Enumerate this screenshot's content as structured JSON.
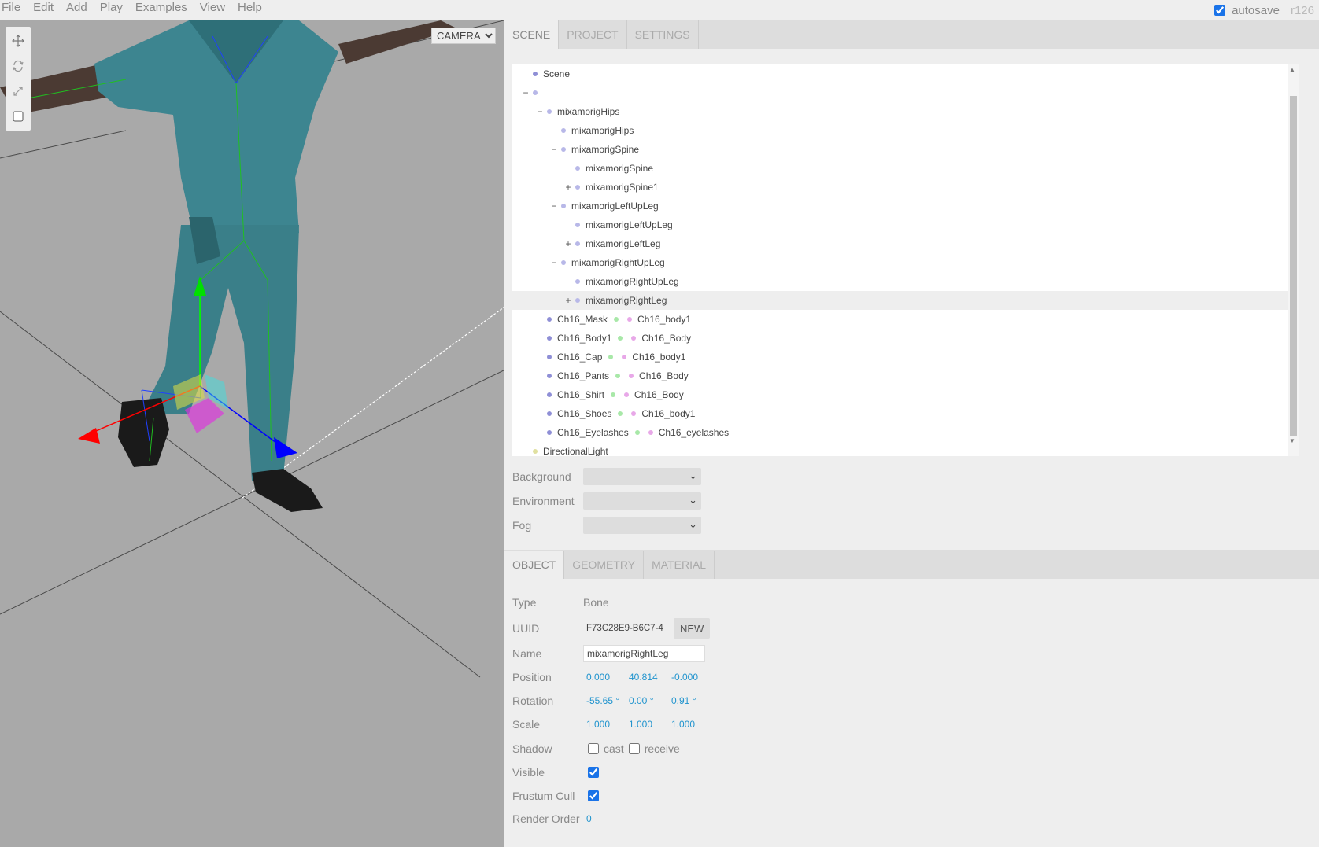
{
  "menubar": {
    "items": [
      "File",
      "Edit",
      "Add",
      "Play",
      "Examples",
      "View",
      "Help"
    ],
    "autosave_label": "autosave",
    "autosave_checked": true,
    "version": "r126"
  },
  "viewport": {
    "camera_select": "CAMERA",
    "tools": [
      "translate-icon",
      "rotate-icon",
      "scale-icon",
      "local-icon"
    ]
  },
  "sidebar": {
    "tabs": [
      "SCENE",
      "PROJECT",
      "SETTINGS"
    ],
    "selected_tab": "SCENE",
    "outliner": [
      {
        "opener": "",
        "level": 0,
        "label": "Scene",
        "dot": "#8f8fd6"
      },
      {
        "opener": "−",
        "level": 0,
        "label": "",
        "dot": "#b8b8e8"
      },
      {
        "opener": "−",
        "level": 1,
        "label": "mixamorigHips",
        "dot": "#b8b8e8"
      },
      {
        "opener": "",
        "level": 2,
        "label": "mixamorigHips",
        "dot": "#b8b8e8"
      },
      {
        "opener": "−",
        "level": 2,
        "label": "mixamorigSpine",
        "dot": "#b8b8e8"
      },
      {
        "opener": "",
        "level": 3,
        "label": "mixamorigSpine",
        "dot": "#b8b8e8"
      },
      {
        "opener": "+",
        "level": 3,
        "label": "mixamorigSpine1",
        "dot": "#b8b8e8"
      },
      {
        "opener": "−",
        "level": 2,
        "label": "mixamorigLeftUpLeg",
        "dot": "#b8b8e8"
      },
      {
        "opener": "",
        "level": 3,
        "label": "mixamorigLeftUpLeg",
        "dot": "#b8b8e8"
      },
      {
        "opener": "+",
        "level": 3,
        "label": "mixamorigLeftLeg",
        "dot": "#b8b8e8"
      },
      {
        "opener": "−",
        "level": 2,
        "label": "mixamorigRightUpLeg",
        "dot": "#b8b8e8"
      },
      {
        "opener": "",
        "level": 3,
        "label": "mixamorigRightUpLeg",
        "dot": "#b8b8e8"
      },
      {
        "opener": "+",
        "level": 3,
        "label": "mixamorigRightLeg",
        "dot": "#b8b8e8",
        "active": true
      },
      {
        "opener": "",
        "level": 1,
        "label": "Ch16_Mask",
        "dot": "#8f8fd6",
        "geometry": "Ch16_body1"
      },
      {
        "opener": "",
        "level": 1,
        "label": "Ch16_Body1",
        "dot": "#8f8fd6",
        "geometry": "Ch16_Body"
      },
      {
        "opener": "",
        "level": 1,
        "label": "Ch16_Cap",
        "dot": "#8f8fd6",
        "geometry": "Ch16_body1"
      },
      {
        "opener": "",
        "level": 1,
        "label": "Ch16_Pants",
        "dot": "#8f8fd6",
        "geometry": "Ch16_Body"
      },
      {
        "opener": "",
        "level": 1,
        "label": "Ch16_Shirt",
        "dot": "#8f8fd6",
        "geometry": "Ch16_Body"
      },
      {
        "opener": "",
        "level": 1,
        "label": "Ch16_Shoes",
        "dot": "#8f8fd6",
        "geometry": "Ch16_body1"
      },
      {
        "opener": "",
        "level": 1,
        "label": "Ch16_Eyelashes",
        "dot": "#8f8fd6",
        "geometry": "Ch16_eyelashes"
      },
      {
        "opener": "",
        "level": 0,
        "label": "DirectionalLight",
        "dot": "#e0e0a0"
      }
    ],
    "geometry_dot": "#a8e8a8",
    "material_dot": "#e8a8e8",
    "background_label": "Background",
    "environment_label": "Environment",
    "fog_label": "Fog"
  },
  "properties": {
    "tabs": [
      "OBJECT",
      "GEOMETRY",
      "MATERIAL"
    ],
    "selected_tab": "OBJECT",
    "type_label": "Type",
    "type_value": "Bone",
    "uuid_label": "UUID",
    "uuid_value": "F73C28E9-B6C7-4",
    "new_button": "NEW",
    "name_label": "Name",
    "name_value": "mixamorigRightLeg",
    "position_label": "Position",
    "position": [
      "0.000",
      "40.814",
      "-0.000"
    ],
    "rotation_label": "Rotation",
    "rotation": [
      "-55.65 °",
      "0.00 °",
      "0.91 °"
    ],
    "scale_label": "Scale",
    "scale": [
      "1.000",
      "1.000",
      "1.000"
    ],
    "shadow_label": "Shadow",
    "cast_label": "cast",
    "receive_label": "receive",
    "visible_label": "Visible",
    "frustum_label": "Frustum Cull",
    "render_order_label": "Render Order",
    "render_order": "0",
    "userdata_value": "{"
  }
}
